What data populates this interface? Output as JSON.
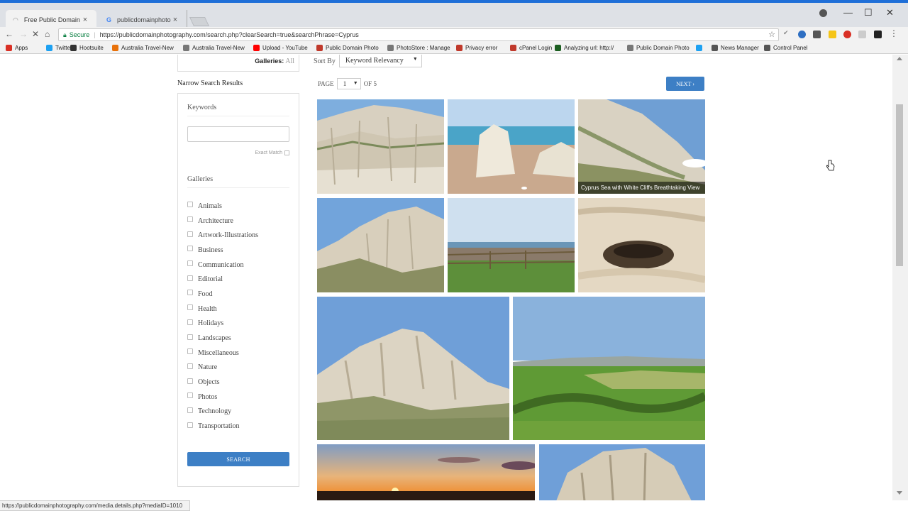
{
  "browser": {
    "tabs": [
      {
        "label": "Free Public Domain Imag",
        "active": true
      },
      {
        "label": "publicdomainphotograp",
        "active": false
      }
    ],
    "window_controls": {
      "minimize": "—",
      "maximize": "☐",
      "close": "✕"
    },
    "secure_label": "Secure",
    "url": "https://publicdomainphotography.com/search.php?clearSearch=true&searchPhrase=Cyprus",
    "bookmarks": [
      {
        "label": "Apps",
        "icon": "apps-grid-icon",
        "color": "#d93025"
      },
      {
        "label": "Twitter",
        "icon": "twitter-icon",
        "color": "#1da1f2"
      },
      {
        "label": "Hootsuite",
        "icon": "hootsuite-icon",
        "color": "#333333"
      },
      {
        "label": "Australia Travel-New",
        "icon": "bookmark-icon",
        "color": "#e8710a"
      },
      {
        "label": "Australia Travel-New",
        "icon": "page-icon",
        "color": "#777777"
      },
      {
        "label": "Upload - YouTube",
        "icon": "youtube-icon",
        "color": "#ff0000"
      },
      {
        "label": "Public Domain Photo",
        "icon": "pdp-icon",
        "color": "#c0392b"
      },
      {
        "label": "PhotoStore : Manage",
        "icon": "page-icon",
        "color": "#777777"
      },
      {
        "label": "Privacy error",
        "icon": "pdp-icon",
        "color": "#c0392b"
      },
      {
        "label": "cPanel Login",
        "icon": "pdp-icon",
        "color": "#c0392b"
      },
      {
        "label": "Analyzing url: http://",
        "icon": "gt-icon",
        "color": "#1b5e20"
      },
      {
        "label": "Public Domain Photo",
        "icon": "page-icon",
        "color": "#777777"
      },
      {
        "label": "",
        "icon": "twitter-icon",
        "color": "#1da1f2"
      },
      {
        "label": "News Manager",
        "icon": "gear-icon",
        "color": "#555555"
      },
      {
        "label": "Control Panel",
        "icon": "control-panel-icon",
        "color": "#555555"
      }
    ],
    "status_url": "https://publicdomainphotography.com/media.details.php?mediaID=1010"
  },
  "sidebar": {
    "galleries_label": "Galleries:",
    "galleries_value": "All",
    "narrow_title": "Narrow Search Results",
    "keywords_title": "Keywords",
    "keywords_value": "",
    "exact_match_label": "Exact Match",
    "galleries_title": "Galleries",
    "gallery_items": [
      "Animals",
      "Architecture",
      "Artwork-Illustrations",
      "Business",
      "Communication",
      "Editorial",
      "Food",
      "Health",
      "Holidays",
      "Landscapes",
      "Miscellaneous",
      "Nature",
      "Objects",
      "Photos",
      "Technology",
      "Transportation"
    ],
    "search_button": "SEARCH"
  },
  "results": {
    "sort_label": "Sort By",
    "sort_value": "Keyword Relevancy",
    "page_label": "PAGE",
    "page_value": "1",
    "of_label": "OF 5",
    "next_button": "NEXT ›",
    "hover_caption": "Cyprus Sea with White Cliffs Breathtaking View"
  },
  "colors": {
    "accent": "#3d7fc5",
    "sky": "#6f9fd4"
  }
}
